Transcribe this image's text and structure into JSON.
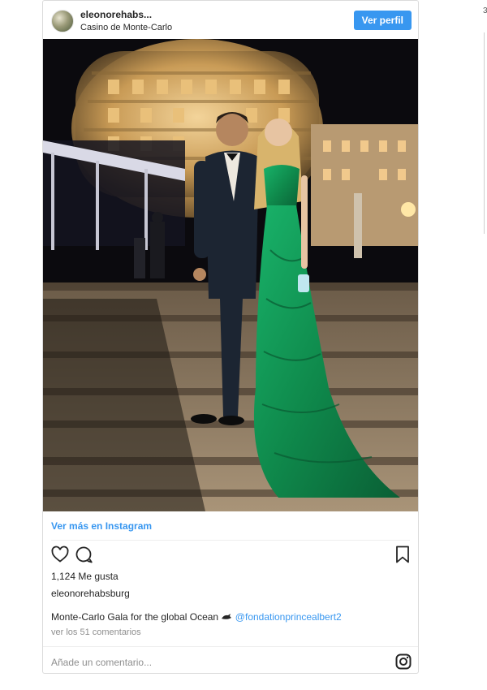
{
  "post": {
    "username": "eleonorehabs...",
    "location": "Casino de Monte-Carlo",
    "profile_button": "Ver perfil",
    "see_more": "Ver más en Instagram",
    "likes": "1,124 Me gusta",
    "owner": "eleonorehabsburg",
    "caption_text": "Monte-Carlo Gala for the global Ocean",
    "caption_mention": "@fondationprincealbert2",
    "comments_link": "ver los 51 comentarios",
    "comment_placeholder": "Añade un comentario..."
  },
  "icons": {
    "like": "heart-icon",
    "comment": "speech-bubble-icon",
    "save": "bookmark-icon",
    "brand": "instagram-icon",
    "caption_emoji": "whale-icon"
  },
  "colors": {
    "accent": "#3897f0",
    "border": "#dbdbdb",
    "muted": "#8e8e8e",
    "dress": "#139a57"
  },
  "side": {
    "char": "3"
  }
}
